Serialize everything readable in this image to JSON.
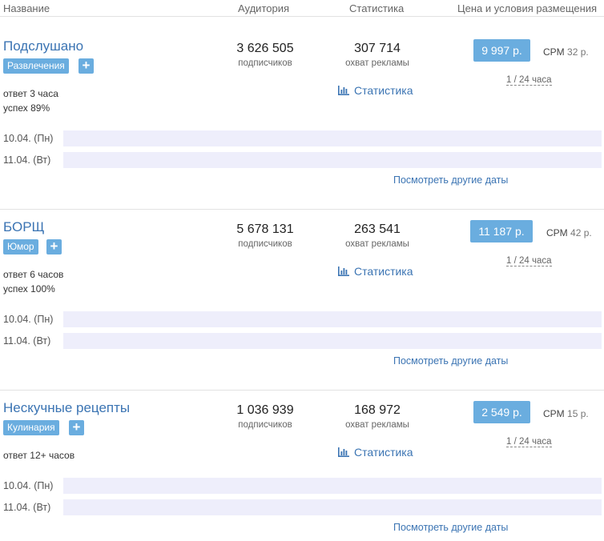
{
  "header": {
    "col_name": "Название",
    "col_audience": "Аудитория",
    "col_stats": "Статистика",
    "col_price": "Цена и условия размещения"
  },
  "listings": [
    {
      "name": "Подслушано",
      "category": "Развлечения",
      "reply_label": "ответ",
      "reply_value": "3 часа",
      "success_label": "успех",
      "success_value": "89%",
      "subscribers": "3 626 505",
      "subscribers_label": "подписчиков",
      "reach": "307 714",
      "reach_label": "охват рекламы",
      "stats_link": "Статистика",
      "price": "9 997 р.",
      "cpm_label": "CPM",
      "cpm_value": "32 р.",
      "terms": "1 / 24 часа",
      "dates": [
        "10.04. (Пн)",
        "11.04. (Вт)"
      ],
      "more_dates": "Посмотреть другие даты"
    },
    {
      "name": "БОРЩ",
      "category": "Юмор",
      "reply_label": "ответ",
      "reply_value": "6 часов",
      "success_label": "успех",
      "success_value": "100%",
      "subscribers": "5 678 131",
      "subscribers_label": "подписчиков",
      "reach": "263 541",
      "reach_label": "охват рекламы",
      "stats_link": "Статистика",
      "price": "11 187 р.",
      "cpm_label": "CPM",
      "cpm_value": "42 р.",
      "terms": "1 / 24 часа",
      "dates": [
        "10.04. (Пн)",
        "11.04. (Вт)"
      ],
      "more_dates": "Посмотреть другие даты"
    },
    {
      "name": "Нескучные рецепты",
      "category": "Кулинария",
      "reply_label": "ответ",
      "reply_value": "12+ часов",
      "subscribers": "1 036 939",
      "subscribers_label": "подписчиков",
      "reach": "168 972",
      "reach_label": "охват рекламы",
      "stats_link": "Статистика",
      "price": "2 549 р.",
      "cpm_label": "CPM",
      "cpm_value": "15 р.",
      "terms": "1 / 24 часа",
      "dates": [
        "10.04. (Пн)",
        "11.04. (Вт)"
      ],
      "more_dates": "Посмотреть другие даты"
    }
  ],
  "icons": {
    "add": "plus-icon",
    "stats": "bar-chart-icon"
  },
  "colors": {
    "accent": "#6aaddf",
    "link": "#3b74b3",
    "date_bar": "#eeeefb"
  }
}
